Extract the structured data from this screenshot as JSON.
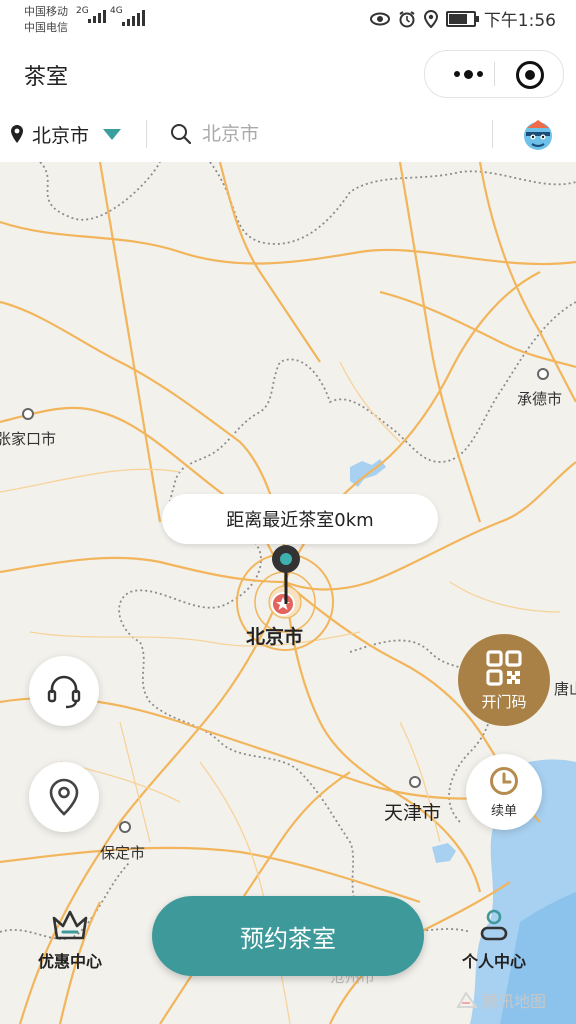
{
  "status_bar": {
    "carrier_1": "中国移动",
    "carrier_2": "中国电信",
    "net_1": "2G",
    "net_2": "4G",
    "time": "下午1:56",
    "battery_level": 0.7
  },
  "nav": {
    "title": "茶室",
    "more_icon": "more-dots-icon",
    "close_icon": "target-circle-icon"
  },
  "search": {
    "city": "北京市",
    "placeholder": "北京市"
  },
  "map": {
    "labels": {
      "beijing": "北京市",
      "tianjin": "天津市",
      "chengde": "承德市",
      "zhangjiakou": "张家口市",
      "baoding": "保定市",
      "tangshan": "唐山",
      "cangzhou": "沧州市"
    },
    "distance_bubble": "距离最近茶室0km",
    "attribution": "腾讯地图"
  },
  "buttons": {
    "support_icon": "headset-icon",
    "location_icon": "location-pin-icon",
    "open_code": "开门码",
    "renew": "续单",
    "book": "预约茶室"
  },
  "tabs": {
    "discounts": "优惠中心",
    "profile": "个人中心"
  },
  "colors": {
    "accent": "#3e9a9a",
    "gold": "#a98147",
    "road": "#f2b55b",
    "water": "#a8d0f0"
  }
}
